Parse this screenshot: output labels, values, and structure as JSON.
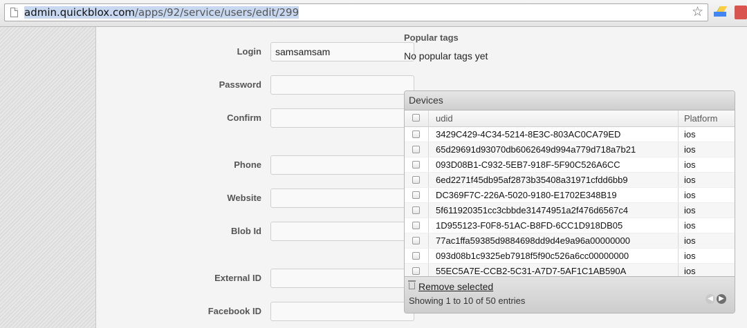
{
  "browser": {
    "url_domain": "admin.quickblox.com",
    "url_path": "/apps/92/service/users/edit/299",
    "star_icon": "star-icon",
    "drive_icon": "google-drive-icon"
  },
  "form": {
    "fields": [
      {
        "label": "Login",
        "value": "samsamsam"
      },
      {
        "label": "Password",
        "value": ""
      },
      {
        "label": "Confirm",
        "value": ""
      },
      {
        "label": "Phone",
        "value": ""
      },
      {
        "label": "Website",
        "value": ""
      },
      {
        "label": "Blob Id",
        "value": ""
      },
      {
        "label": "External ID",
        "value": ""
      },
      {
        "label": "Facebook ID",
        "value": ""
      }
    ]
  },
  "tags": {
    "title": "Popular tags",
    "empty": "No popular tags yet"
  },
  "devices": {
    "title": "Devices",
    "columns": [
      "udid",
      "Platform"
    ],
    "rows": [
      {
        "udid": "3429C429-4C34-5214-8E3C-803AC0CA79ED",
        "platform": "ios"
      },
      {
        "udid": "65d29691d93070db6062649d994a779d718a7b21",
        "platform": "ios"
      },
      {
        "udid": "093D08B1-C932-5EB7-918F-5F90C526A6CC",
        "platform": "ios"
      },
      {
        "udid": "6ed2271f45db95af2873b35408a31971cfdd6bb9",
        "platform": "ios"
      },
      {
        "udid": "DC369F7C-226A-5020-9180-E1702E348B19",
        "platform": "ios"
      },
      {
        "udid": "5f611920351cc3cbbde31474951a2f476d6567c4",
        "platform": "ios"
      },
      {
        "udid": "1D955123-F0F8-51AC-B8FD-6CC1D918DB05",
        "platform": "ios"
      },
      {
        "udid": "77ac1ffa59385d9884698dd9d4e9a96a00000000",
        "platform": "ios"
      },
      {
        "udid": "093d08b1c9325eb7918f5f90c526a6cc00000000",
        "platform": "ios"
      },
      {
        "udid": "55EC5A7E-CCB2-5C31-A7D7-5AF1C1AB590A",
        "platform": "ios"
      }
    ],
    "remove_selected": "Remove selected",
    "showing": "Showing 1 to 10 of 50 entries"
  }
}
